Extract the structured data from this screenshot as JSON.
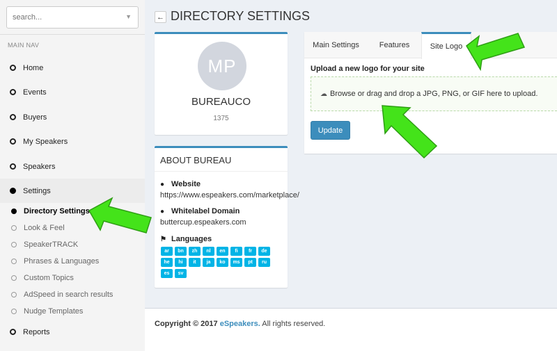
{
  "search": {
    "placeholder": "search..."
  },
  "sidebar": {
    "header": "MAIN NAV",
    "items": [
      {
        "label": "Home"
      },
      {
        "label": "Events"
      },
      {
        "label": "Buyers"
      },
      {
        "label": "My Speakers"
      },
      {
        "label": "Speakers"
      },
      {
        "label": "Settings"
      }
    ],
    "sub_items": [
      {
        "label": "Directory Settings"
      },
      {
        "label": "Look & Feel"
      },
      {
        "label": "SpeakerTRACK"
      },
      {
        "label": "Phrases & Languages"
      },
      {
        "label": "Custom Topics"
      },
      {
        "label": "AdSpeed in search results"
      },
      {
        "label": "Nudge Templates"
      }
    ],
    "reports": {
      "label": "Reports"
    }
  },
  "page": {
    "title": "DIRECTORY SETTINGS"
  },
  "profile": {
    "initials": "MP",
    "name": "BUREAUCO",
    "id": "1375"
  },
  "about": {
    "title": "ABOUT BUREAU",
    "website_label": "Website",
    "website_value": "https://www.espeakers.com/marketplace/",
    "whitelabel_label": "Whitelabel Domain",
    "whitelabel_value": "buttercup.espeakers.com",
    "languages_label": "Languages",
    "languages": [
      "ar",
      "bn",
      "zh",
      "nl",
      "en",
      "fi",
      "fr",
      "de",
      "he",
      "hi",
      "it",
      "ja",
      "ko",
      "ms",
      "pt",
      "ru",
      "es",
      "sv"
    ]
  },
  "tabs": [
    {
      "label": "Main Settings"
    },
    {
      "label": "Features"
    },
    {
      "label": "Site Logo"
    }
  ],
  "upload": {
    "label": "Upload a new logo for your site",
    "dropzone_text": "Browse or drag and drop a JPG, PNG, or GIF here to upload.",
    "button": "Update"
  },
  "footer": {
    "prefix": "Copyright © 2017",
    "link": "eSpeakers.",
    "suffix": "All rights reserved."
  },
  "colors": {
    "accent": "#3c8dbc",
    "lang_badge": "#00b4e6",
    "arrow": "#44e31a"
  }
}
